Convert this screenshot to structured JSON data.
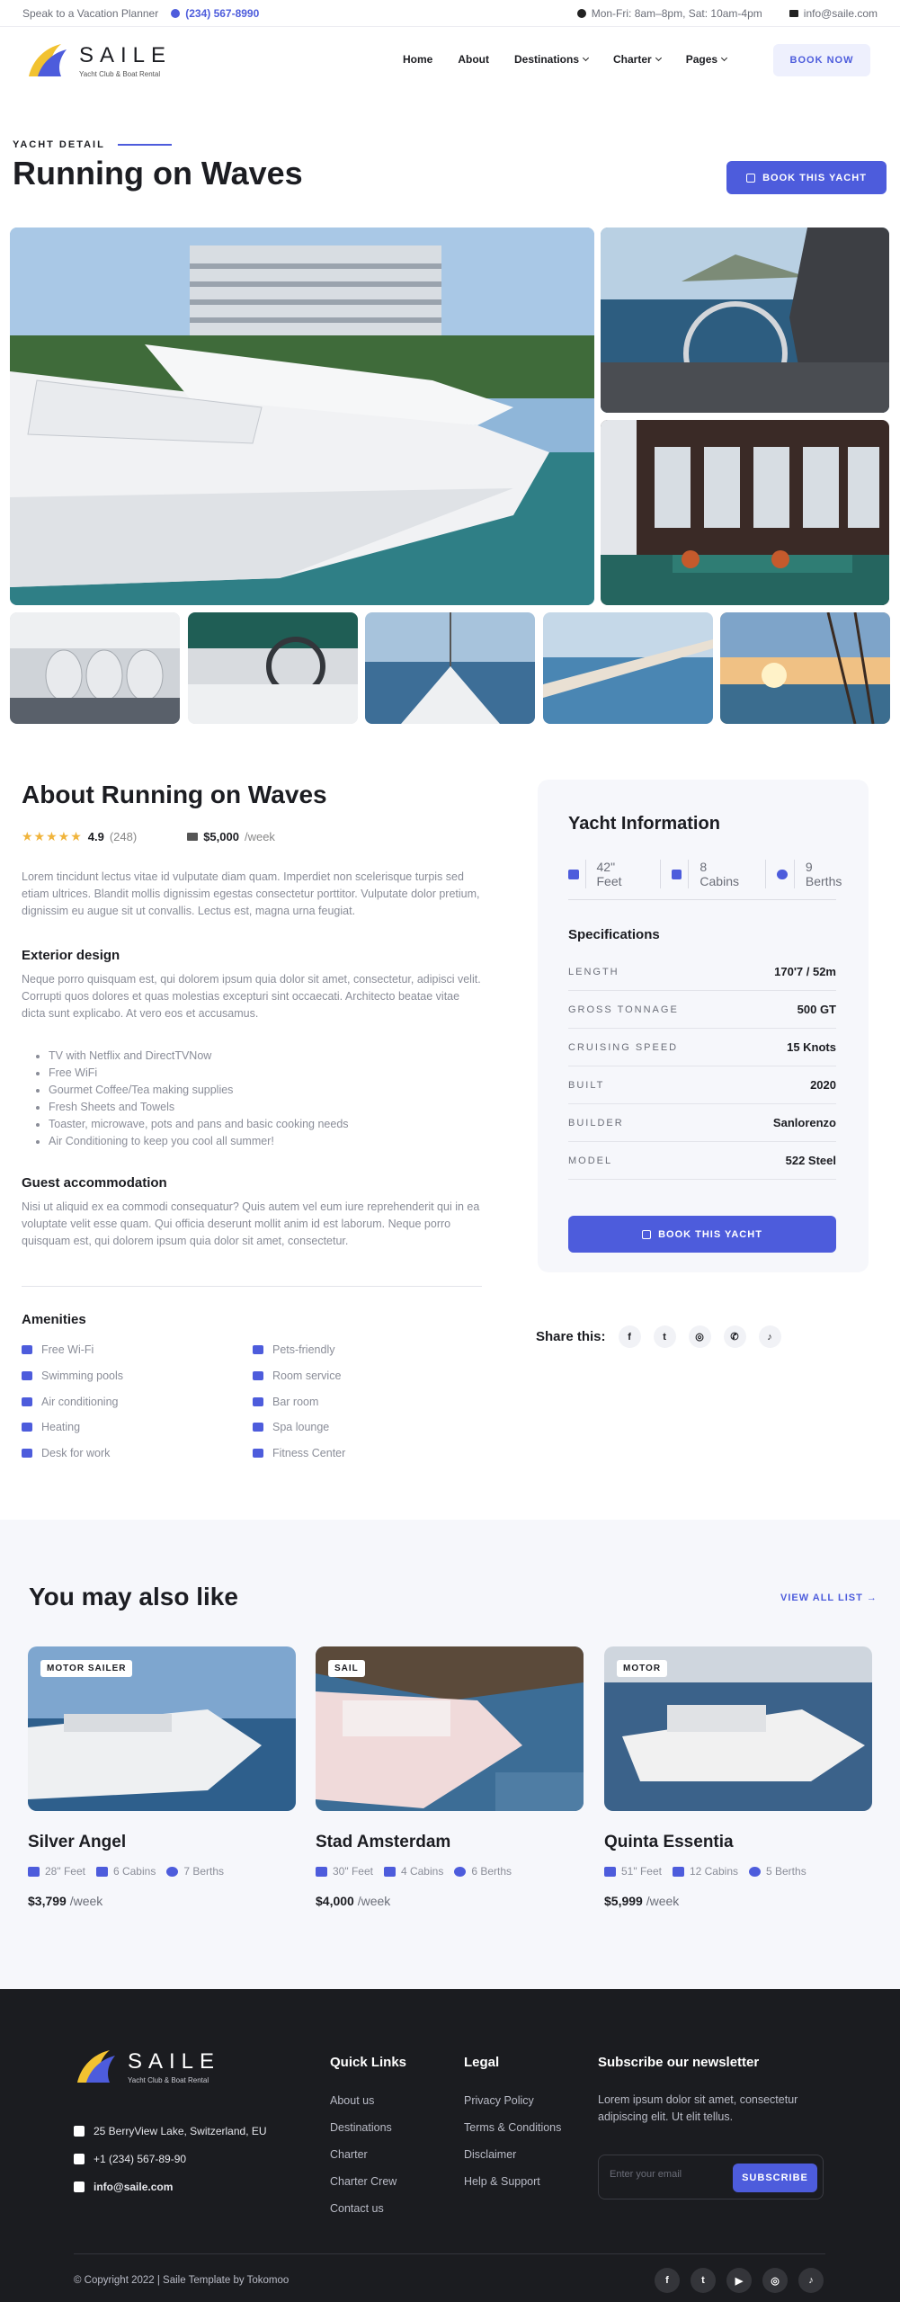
{
  "topbar": {
    "planner": "Speak to a Vacation Planner",
    "phone": "(234) 567-8990",
    "hours": "Mon-Fri: 8am–8pm, Sat: 10am-4pm",
    "email": "info@saile.com"
  },
  "brand": {
    "name": "SAILE",
    "tagline": "Yacht Club & Boat Rental"
  },
  "nav": {
    "items": [
      "Home",
      "About",
      "Destinations",
      "Charter",
      "Pages"
    ],
    "book_now": "BOOK NOW"
  },
  "hero": {
    "eyebrow": "YACHT DETAIL",
    "title": "Running on Waves",
    "book_button": "BOOK THIS YACHT"
  },
  "about": {
    "title": "About Running on Waves",
    "rating": "4.9",
    "reviews": "(248)",
    "price": "$5,000",
    "per": "/week",
    "intro": "Lorem tincidunt lectus vitae id vulputate diam quam. Imperdiet non scelerisque turpis sed etiam ultrices. Blandit mollis dignissim egestas consectetur porttitor. Vulputate dolor pretium, dignissim eu augue sit ut convallis. Lectus est, magna urna feugiat.",
    "exterior_title": "Exterior design",
    "exterior_text": "Neque porro quisquam est, qui dolorem ipsum quia dolor sit amet, consectetur, adipisci velit. Corrupti quos dolores et quas molestias excepturi sint occaecati. Architecto beatae vitae dicta sunt explicabo. At vero eos et accusamus.",
    "features": [
      "TV with Netflix and DirectTVNow",
      "Free WiFi",
      "Gourmet Coffee/Tea making supplies",
      "Fresh Sheets and Towels",
      "Toaster, microwave, pots and pans and basic cooking needs",
      "Air Conditioning to keep you cool all summer!"
    ],
    "guest_title": "Guest accommodation",
    "guest_text": "Nisi ut aliquid ex ea commodi consequatur? Quis autem vel eum iure reprehenderit qui in ea voluptate velit esse quam. Qui officia deserunt mollit anim id est laborum. Neque porro quisquam est, qui dolorem ipsum quia dolor sit amet, consectetur."
  },
  "amenities": {
    "title": "Amenities",
    "left": [
      "Free Wi-Fi",
      "Swimming pools",
      "Air conditioning",
      "Heating",
      "Desk for work"
    ],
    "right": [
      "Pets-friendly",
      "Room service",
      "Bar room",
      "Spa lounge",
      "Fitness Center"
    ]
  },
  "info": {
    "title": "Yacht Information",
    "length": "42\" Feet",
    "cabins": "8 Cabins",
    "berths": "9 Berths",
    "spec_title": "Specifications",
    "specs": [
      {
        "k": "LENGTH",
        "v": "170'7 / 52m"
      },
      {
        "k": "GROSS TONNAGE",
        "v": "500 GT"
      },
      {
        "k": "CRUISING SPEED",
        "v": "15 Knots"
      },
      {
        "k": "BUILT",
        "v": "2020"
      },
      {
        "k": "BUILDER",
        "v": "Sanlorenzo"
      },
      {
        "k": "MODEL",
        "v": "522 Steel"
      }
    ],
    "book_button": "BOOK THIS YACHT"
  },
  "share": {
    "label": "Share this:",
    "icons": [
      "facebook-icon",
      "twitter-icon",
      "instagram-icon",
      "whatsapp-icon",
      "tiktok-icon"
    ]
  },
  "also": {
    "title": "You may also like",
    "view_all": "VIEW ALL LIST",
    "cards": [
      {
        "badge": "MOTOR SAILER",
        "name": "Silver Angel",
        "feet": "28\" Feet",
        "cabins": "6 Cabins",
        "berths": "7 Berths",
        "price": "$3,799",
        "per": "/week"
      },
      {
        "badge": "SAIL",
        "name": "Stad Amsterdam",
        "feet": "30\" Feet",
        "cabins": "4 Cabins",
        "berths": "6 Berths",
        "price": "$4,000",
        "per": "/week"
      },
      {
        "badge": "MOTOR",
        "name": "Quinta Essentia",
        "feet": "51\" Feet",
        "cabins": "12 Cabins",
        "berths": "5 Berths",
        "price": "$5,999",
        "per": "/week"
      }
    ]
  },
  "footer": {
    "address": "25 BerryView Lake, Switzerland, EU",
    "phone": "+1 (234) 567-89-90",
    "email": "info@saile.com",
    "quick_title": "Quick Links",
    "quick": [
      "About us",
      "Destinations",
      "Charter",
      "Charter Crew",
      "Contact us"
    ],
    "legal_title": "Legal",
    "legal": [
      "Privacy Policy",
      "Terms & Conditions",
      "Disclaimer",
      "Help & Support"
    ],
    "news_title": "Subscribe our newsletter",
    "news_text": "Lorem ipsum dolor sit amet, consectetur adipiscing elit. Ut elit tellus.",
    "placeholder": "Enter your email",
    "subscribe": "SUBSCRIBE",
    "copyright": "© Copyright 2022 | Saile Template by Tokomoo"
  },
  "colors": {
    "accent": "#4d5cdc",
    "footer_bg": "#1b1c20",
    "star": "#f0b43c"
  }
}
